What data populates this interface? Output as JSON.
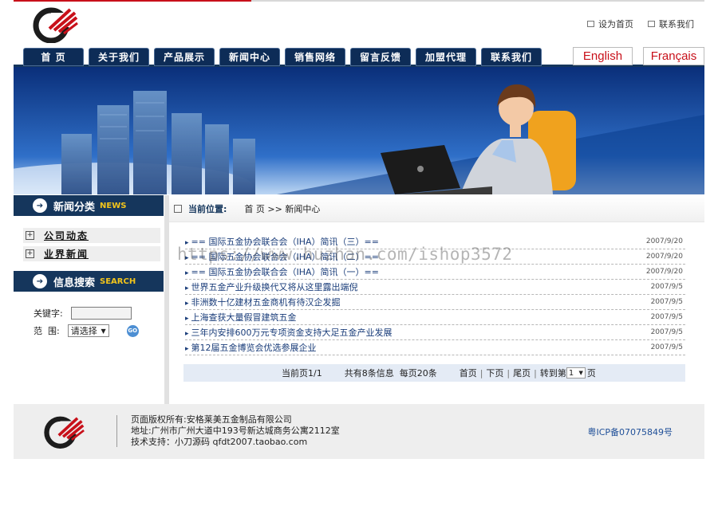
{
  "header": {
    "set_home": "设为首页",
    "contact": "联系我们"
  },
  "nav": {
    "items": [
      "首 页",
      "关于我们",
      "产品展示",
      "新闻中心",
      "销售网络",
      "留言反馈",
      "加盟代理",
      "联系我们"
    ],
    "lang_en": "English",
    "lang_fr": "Français"
  },
  "sidebar": {
    "news_title": "新闻分类",
    "news_title_en": "NEWS",
    "categories": [
      "公司动态",
      "业界新闻"
    ],
    "search_title": "信息搜索",
    "search_title_en": "SEARCH",
    "keyword_label": "关键字:",
    "range_label": "范  围:",
    "range_select": "请选择",
    "go_label": "GO"
  },
  "breadcrumb": {
    "current_label": "当前位置:",
    "path": "首 页 >> 新闻中心"
  },
  "news": [
    {
      "title": "== 国际五金协会联合会（IHA）简讯（三）==",
      "date": "2007/9/20"
    },
    {
      "title": "== 国际五金协会联合会（IHA）简讯（二）==",
      "date": "2007/9/20"
    },
    {
      "title": "== 国际五金协会联合会（IHA）简讯（一）==",
      "date": "2007/9/20"
    },
    {
      "title": "世界五金产业升级换代又将从这里露出端倪",
      "date": "2007/9/5"
    },
    {
      "title": "非洲数十亿建材五金商机有待汉企发掘",
      "date": "2007/9/5"
    },
    {
      "title": "上海查获大量假冒建筑五金",
      "date": "2007/9/5"
    },
    {
      "title": "三年内安排600万元专项资金支持大足五金产业发展",
      "date": "2007/9/5"
    },
    {
      "title": "第12届五金博览会优选参展企业",
      "date": "2007/9/5"
    }
  ],
  "pager": {
    "current": "当前页1/1",
    "summary": "共有8条信息  每页20条",
    "first": "首页",
    "prev": "下页",
    "last": "尾页",
    "goto": "转到第",
    "page_value": "1",
    "page_suffix": "页",
    "sep": "|"
  },
  "footer": {
    "copyright": "页面版权所有:安格莱美五金制品有限公司",
    "address": "地址:广州市广州大道中193号新达城商务公寓2112室",
    "support": "技术支持：小刀源码 qfdt2007.taobao.com",
    "icp": "粤ICP备07075849号"
  },
  "watermark": "https://www.huzhan.com/ishop3572",
  "colors": {
    "nav_bg": "#0d2c57",
    "accent_red": "#c8101a",
    "pager_bg": "#e4ebf5"
  }
}
